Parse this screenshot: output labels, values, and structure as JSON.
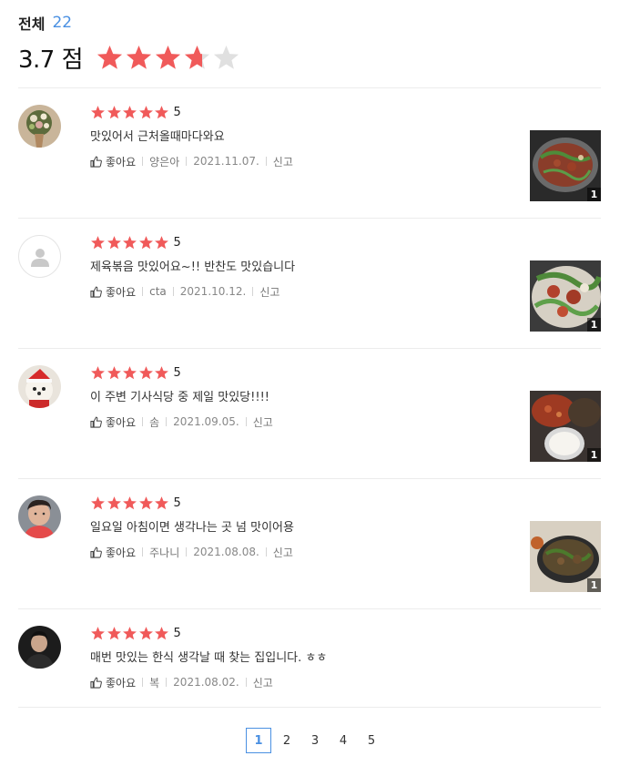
{
  "summary": {
    "total_label": "전체",
    "total_count": "22",
    "score": "3.7 점",
    "score_value": 3.7,
    "star_color": "#f05a5a",
    "star_empty_color": "#e0e0e0"
  },
  "reviews": [
    {
      "rating": "5",
      "text": "맛있어서 근처올때마다와요",
      "like_label": "좋아요",
      "author": "양은아",
      "date": "2021.11.07.",
      "report_label": "신고",
      "photo_count": "1",
      "avatar": "flower-bouquet"
    },
    {
      "rating": "5",
      "text": "제육볶음 맛있어요~!! 반찬도 맛있습니다",
      "like_label": "좋아요",
      "author": "cta",
      "date": "2021.10.12.",
      "report_label": "신고",
      "photo_count": "1",
      "avatar": "default-user"
    },
    {
      "rating": "5",
      "text": "이 주변 기사식당 중 제일 맛있당!!!!",
      "like_label": "좋아요",
      "author": "솜",
      "date": "2021.09.05.",
      "report_label": "신고",
      "photo_count": "1",
      "avatar": "puppy-santa"
    },
    {
      "rating": "5",
      "text": "일요일 아침이면 생각나는 곳 넘 맛이어용",
      "like_label": "좋아요",
      "author": "주나니",
      "date": "2021.08.08.",
      "report_label": "신고",
      "photo_count": "1",
      "avatar": "person-photo"
    },
    {
      "rating": "5",
      "text": "매번 맛있는 한식 생각날 때 찾는 집입니다. ㅎㅎ",
      "like_label": "좋아요",
      "author": "복",
      "date": "2021.08.02.",
      "report_label": "신고",
      "photo_count": "",
      "avatar": "person-dark"
    }
  ],
  "pagination": {
    "pages": [
      "1",
      "2",
      "3",
      "4",
      "5"
    ],
    "active": "1"
  }
}
